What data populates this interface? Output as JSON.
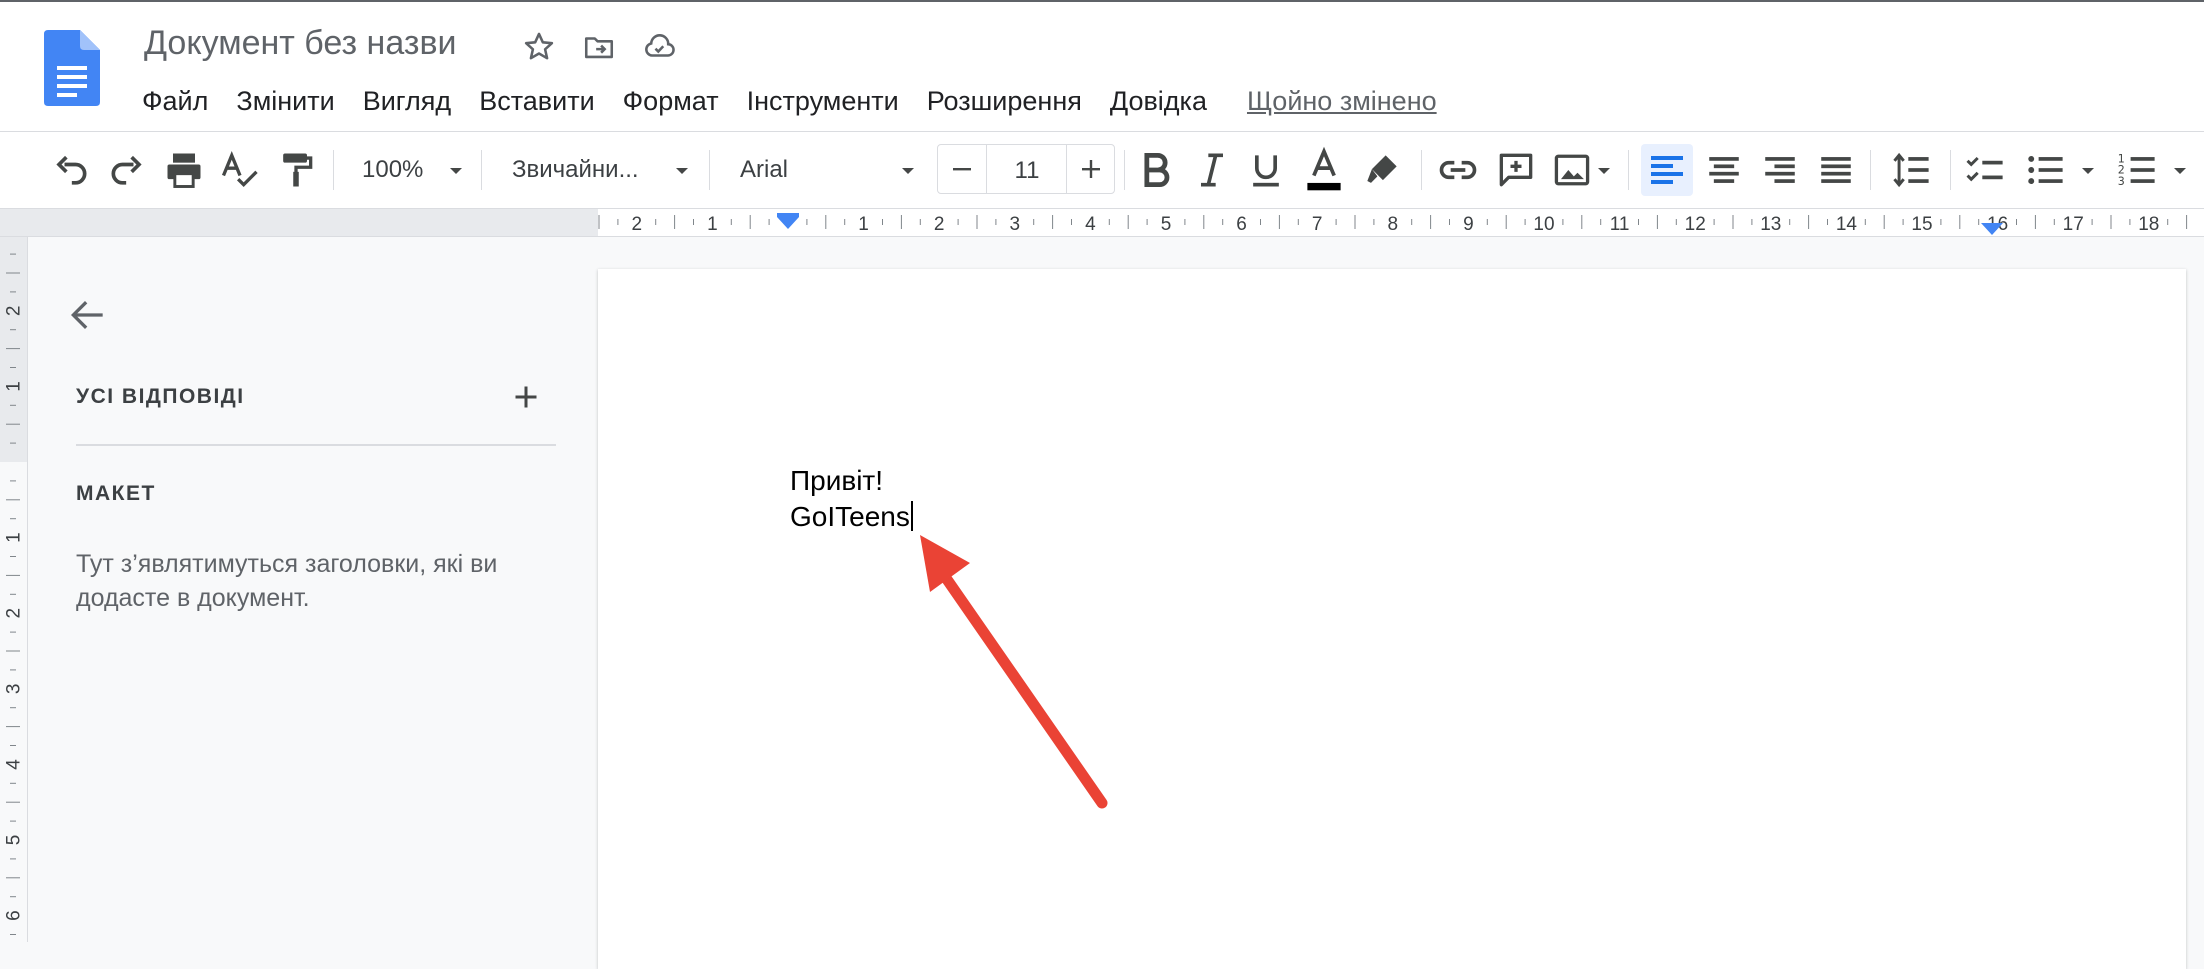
{
  "app": {
    "title": "Документ без назви",
    "last_edit": "Щойно змінено"
  },
  "menu": [
    "Файл",
    "Змінити",
    "Вигляд",
    "Вставити",
    "Формат",
    "Інструменти",
    "Розширення",
    "Довідка"
  ],
  "toolbar": {
    "zoom": "100%",
    "style": "Звичайни...",
    "font": "Arial",
    "font_size": "11"
  },
  "ruler": {
    "horizontal_labels": [
      "2",
      "1",
      "1",
      "2",
      "3",
      "4",
      "5",
      "6",
      "7",
      "8",
      "9",
      "10",
      "11",
      "12",
      "13",
      "14",
      "15",
      "16",
      "17",
      "18"
    ],
    "vertical_labels": [
      "2",
      "1",
      "1",
      "2",
      "3",
      "4",
      "5",
      "6"
    ]
  },
  "outline": {
    "summary_label": "УСІ ВІДПОВІДІ",
    "heading_label": "МАКЕТ",
    "hint": "Тут з’являтимуться заголовки, які ви додасте в документ."
  },
  "document": {
    "lines": [
      "Привіт!",
      "GoITeens"
    ]
  },
  "colors": {
    "accent_blue": "#4285f4",
    "annotation_arrow": "#ea4335",
    "active_button_bg": "#e8f0fe"
  }
}
